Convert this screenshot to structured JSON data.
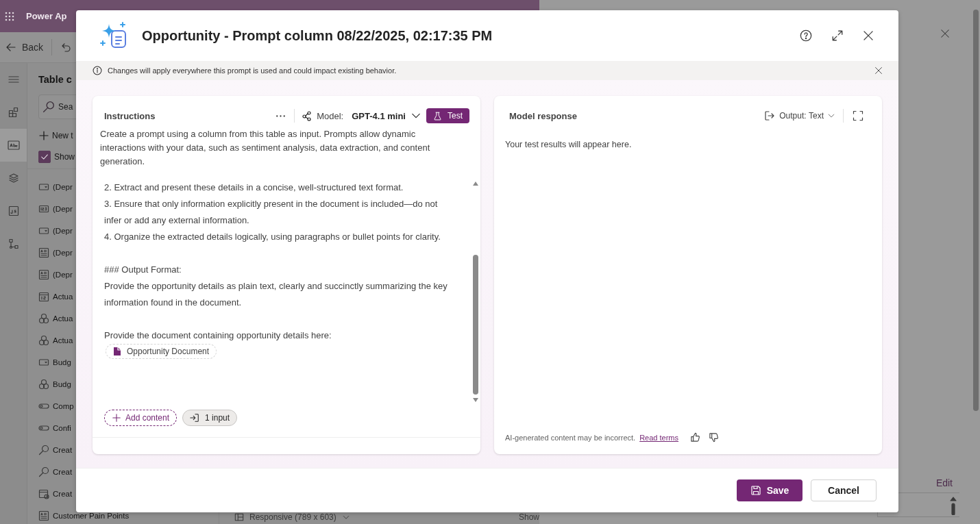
{
  "background": {
    "app_title": "Power Ap",
    "back": "Back",
    "panel_title": "Table c",
    "search_placeholder": "Sea",
    "new_button": "New t",
    "show_checkbox": {
      "label": "Show",
      "checked": true
    },
    "rail": [
      {
        "kind": "menu",
        "selected": false
      },
      {
        "kind": "dashboard",
        "selected": false
      },
      {
        "kind": "text",
        "selected": true
      },
      {
        "kind": "layers",
        "selected": false
      },
      {
        "kind": "script",
        "selected": false
      },
      {
        "kind": "flow",
        "selected": false
      }
    ],
    "fields": [
      {
        "kind": "choice",
        "label": "(Depr"
      },
      {
        "kind": "number",
        "label": "(Depr"
      },
      {
        "kind": "choice",
        "label": "(Depr"
      },
      {
        "kind": "text",
        "label": "(Depr"
      },
      {
        "kind": "text",
        "label": "(Depr"
      },
      {
        "kind": "date",
        "label": "Actua"
      },
      {
        "kind": "currency",
        "label": "Actua"
      },
      {
        "kind": "currency",
        "label": "Actua"
      },
      {
        "kind": "choice",
        "label": "Budg"
      },
      {
        "kind": "currency",
        "label": "Budg"
      },
      {
        "kind": "toggle",
        "label": "Comp"
      },
      {
        "kind": "toggle",
        "label": "Confi"
      },
      {
        "kind": "lookup",
        "label": "Creat"
      },
      {
        "kind": "lookup",
        "label": "Creat"
      },
      {
        "kind": "datetime",
        "label": "Creat"
      },
      {
        "kind": "text",
        "label": "Customer Pain Points"
      }
    ],
    "view_selector": "Responsive (789 x 603)",
    "show_label": "Show",
    "edit_link": "Edit"
  },
  "dialog": {
    "title": "Opportunity - Prompt column 08/22/2025, 02:17:35 PM",
    "notice": "Changes will apply everywhere this prompt is used and could impact existing behavior.",
    "instructions": {
      "title": "Instructions",
      "model_label": "Model:",
      "model": "GPT-4.1 mini",
      "test_button": "Test",
      "description": "Create a prompt using a column from this table as input. Prompts allow dynamic interactions with your data, such as sentiment analysis, data extraction, and content generation.",
      "sections": [
        {
          "lines": [
            "2. Extract and present these details in a concise, well-structured text format.",
            "3. Ensure that only information explicitly present in the document is included—do not infer or add any external information.",
            "4. Organize the extracted details logically, using paragraphs or bullet points for clarity."
          ]
        },
        {
          "lines": [
            "### Output Format:",
            "Provide the opportunity details as plain text, clearly and succinctly summarizing the key information found in the document."
          ]
        },
        {
          "lines": [
            "Provide the document containing opportunity details here:"
          ],
          "chip": "Opportunity Document"
        }
      ],
      "add_content": "Add content",
      "inputs": "1 input"
    },
    "response": {
      "title": "Model response",
      "output_label": "Output:",
      "output_value": "Text",
      "placeholder_text": "Your test results will appear here.",
      "disclaimer": "AI-generated content may be incorrect.",
      "terms_link": "Read terms"
    },
    "save": "Save",
    "cancel": "Cancel"
  }
}
